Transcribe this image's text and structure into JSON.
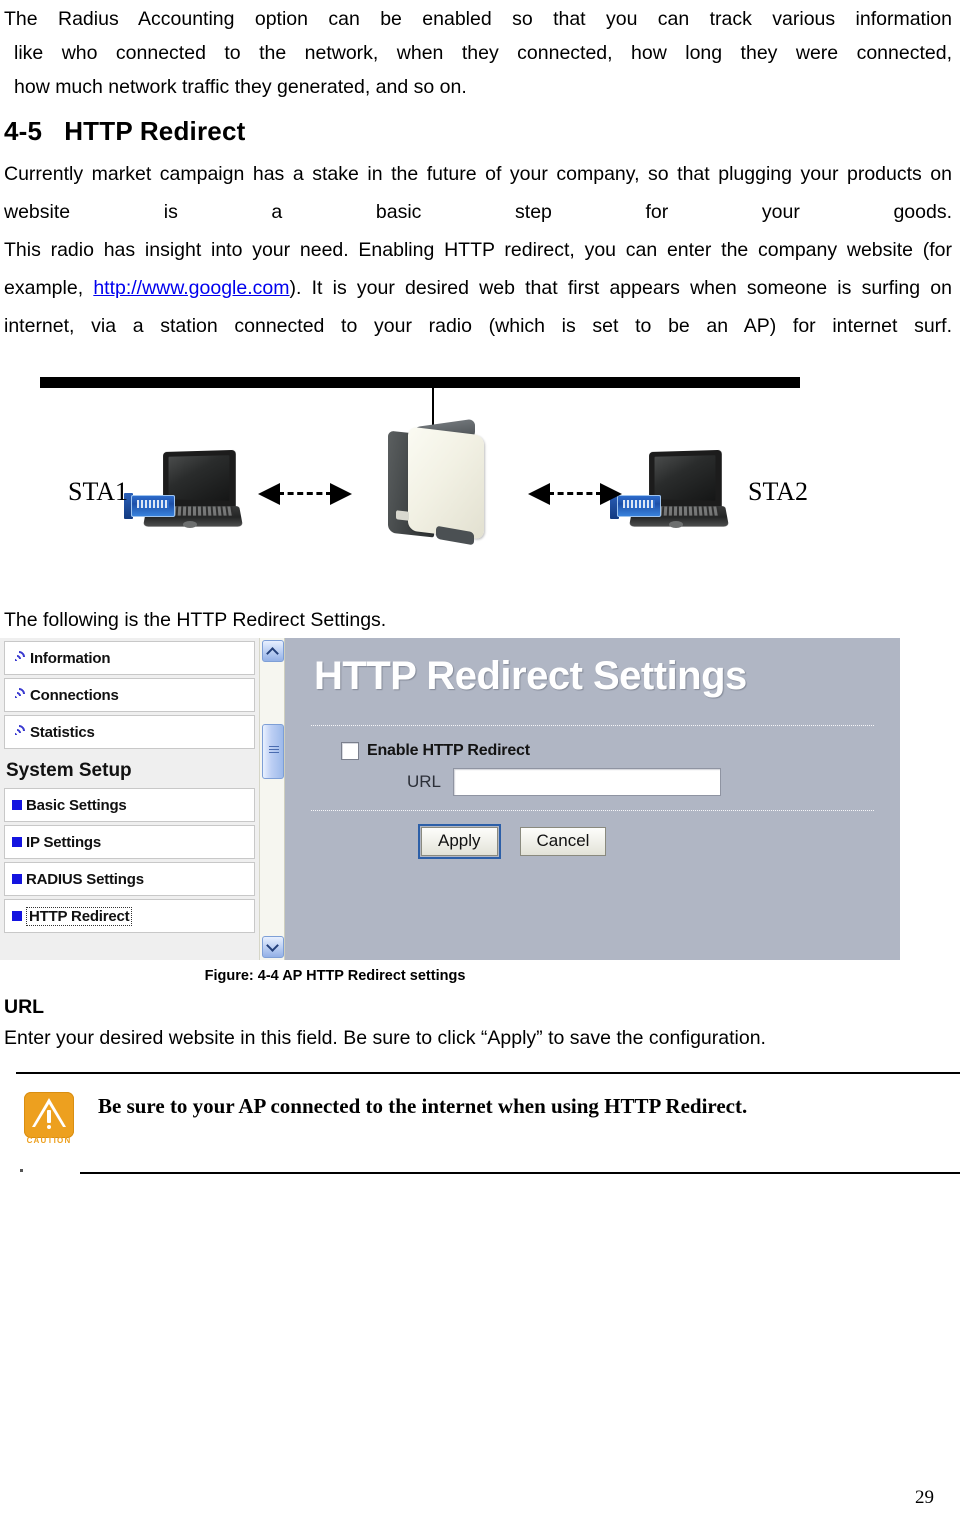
{
  "intro": {
    "lines": [
      "The Radius Accounting option can be enabled so that you can track various information",
      "like who connected to the network, when they connected, how long they were connected,",
      "how much network traffic they generated, and so on."
    ]
  },
  "section": {
    "number": "4-5",
    "title": "HTTP Redirect"
  },
  "paragraphs": {
    "p1": "Currently market campaign has a stake in the future of your company, so that plugging your products on website is a basic step for your goods.",
    "p2_before": "This radio has insight into your need. Enabling HTTP redirect, you can enter the company website (for example, ",
    "p2_link": "http://www.google.com",
    "p2_after": "). It is your desired web that first appears when someone is surfing on internet, via a station connected to your radio (which is set to be an AP) for internet surf."
  },
  "diagram": {
    "sta1_label": "STA1",
    "sta2_label": "STA2"
  },
  "follow_line": "The following is the HTTP Redirect Settings.",
  "ui": {
    "sidebar": {
      "top_items": [
        {
          "label": "Information",
          "icon": "wifi-wave-icon"
        },
        {
          "label": "Connections",
          "icon": "wifi-wave-icon"
        },
        {
          "label": "Statistics",
          "icon": "wifi-wave-icon"
        }
      ],
      "group_title": "System Setup",
      "group_items": [
        {
          "label": "Basic Settings",
          "selected": false
        },
        {
          "label": "IP Settings",
          "selected": false
        },
        {
          "label": "RADIUS Settings",
          "selected": false
        },
        {
          "label": "HTTP Redirect",
          "selected": true
        }
      ]
    },
    "panel": {
      "title": "HTTP Redirect Settings",
      "checkbox_label": "Enable HTTP Redirect",
      "checkbox_checked": false,
      "url_label": "URL",
      "url_value": "",
      "url_placeholder": "",
      "apply_label": "Apply",
      "cancel_label": "Cancel",
      "background_color": "#b0b6c4",
      "accent_color": "#2c5fa8"
    }
  },
  "figure_caption": "Figure: 4-4 AP HTTP Redirect settings",
  "url_section": {
    "heading": "URL",
    "body": "Enter your desired website in this field. Be sure to click “Apply” to save the configuration."
  },
  "caution": {
    "icon_label": "CAUTION",
    "text": "Be sure to your AP connected to the internet when using HTTP Redirect.",
    "color": "#eda01f"
  },
  "page_number": "29"
}
